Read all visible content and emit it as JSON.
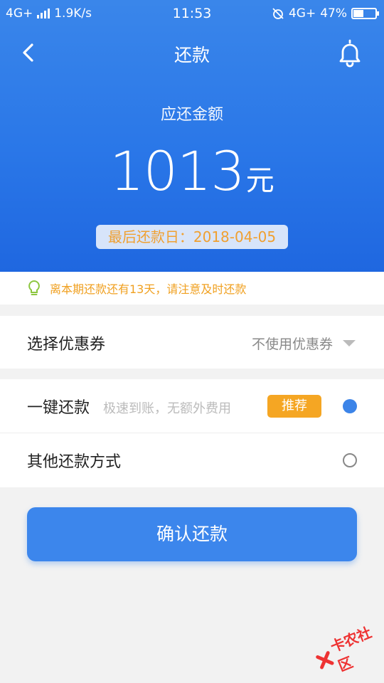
{
  "status_bar": {
    "network_left": "4G+",
    "speed": "1.9K/s",
    "time": "11:53",
    "network_right": "4G+",
    "battery_percent_text": "47%",
    "battery_level": 0.47
  },
  "nav": {
    "title": "还款",
    "back_icon": "chevron-left-icon",
    "bell_icon": "bell-icon"
  },
  "amount": {
    "label": "应还金额",
    "value": "1013",
    "unit": "元",
    "due_date_text": "最后还款日：2018-04-05"
  },
  "notice": {
    "icon": "lightbulb-icon",
    "text": "离本期还款还有13天，请注意及时还款"
  },
  "coupon": {
    "label": "选择优惠券",
    "value": "不使用优惠券"
  },
  "payment_methods": [
    {
      "label": "一键还款",
      "subtitle": "极速到账，无额外费用",
      "badge": "推荐",
      "selected": true
    },
    {
      "label": "其他还款方式",
      "selected": false
    }
  ],
  "confirm_button": "确认还款",
  "watermark": "卡农社区",
  "colors": {
    "header_blue": "#2a77e8",
    "button_blue": "#3c86ec",
    "warning_orange": "#f0a020",
    "badge_orange": "#f5a623",
    "radio_selected": "#3c84e8",
    "watermark_red": "#e33333"
  }
}
